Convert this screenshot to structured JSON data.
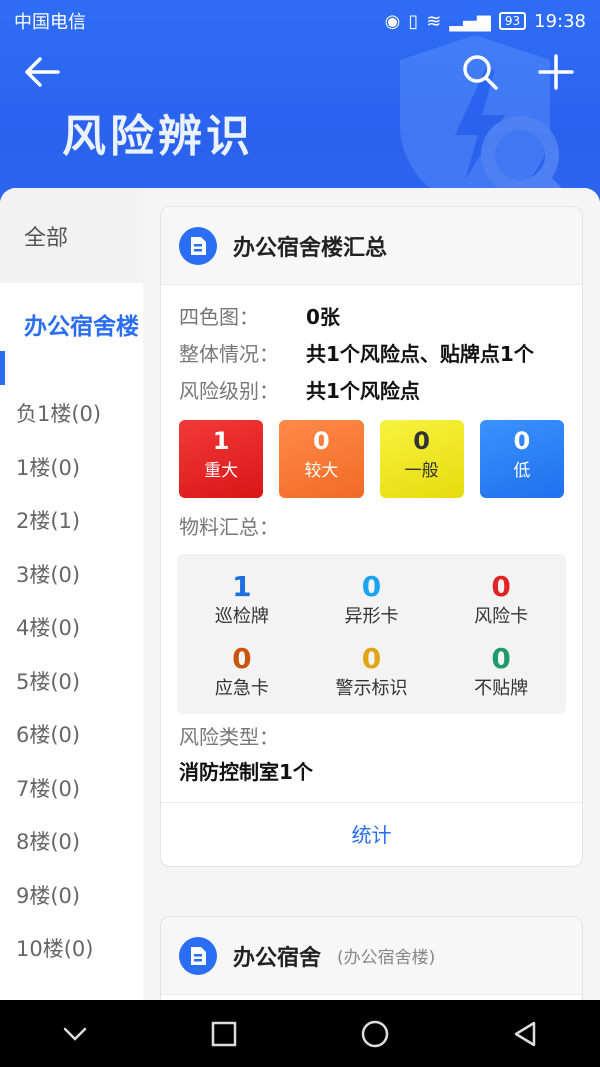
{
  "status": {
    "carrier": "中国电信",
    "battery": "93",
    "time": "19:38"
  },
  "header": {
    "title": "风险辨识"
  },
  "sidebar": {
    "all": "全部",
    "active": "办公宿舍楼",
    "floors": [
      "负1楼(0)",
      "1楼(0)",
      "2楼(1)",
      "3楼(0)",
      "4楼(0)",
      "5楼(0)",
      "6楼(0)",
      "7楼(0)",
      "8楼(0)",
      "9楼(0)",
      "10楼(0)"
    ]
  },
  "card1": {
    "title": "办公宿舍楼汇总",
    "rows": [
      {
        "label": "四色图：",
        "value": "0张"
      },
      {
        "label": "整体情况：",
        "value": "共1个风险点、贴牌点1个"
      },
      {
        "label": "风险级别：",
        "value": "共1个风险点"
      }
    ],
    "levels": [
      {
        "num": "1",
        "label": "重大"
      },
      {
        "num": "0",
        "label": "较大"
      },
      {
        "num": "0",
        "label": "一般"
      },
      {
        "num": "0",
        "label": "低"
      }
    ],
    "materials_label": "物料汇总：",
    "materials": [
      {
        "num": "1",
        "label": "巡检牌",
        "color": "#1f6fe0"
      },
      {
        "num": "0",
        "label": "异形卡",
        "color": "#1aa3f0"
      },
      {
        "num": "0",
        "label": "风险卡",
        "color": "#e02424"
      },
      {
        "num": "0",
        "label": "应急卡",
        "color": "#c8540e"
      },
      {
        "num": "0",
        "label": "警示标识",
        "color": "#e0a414"
      },
      {
        "num": "0",
        "label": "不贴牌",
        "color": "#1f9a6a"
      }
    ],
    "risk_type_label": "风险类型：",
    "risk_type_value": "消防控制室1个",
    "stats": "统计"
  },
  "card2": {
    "title": "办公宿舍",
    "subtitle": "(办公宿舍楼)"
  }
}
